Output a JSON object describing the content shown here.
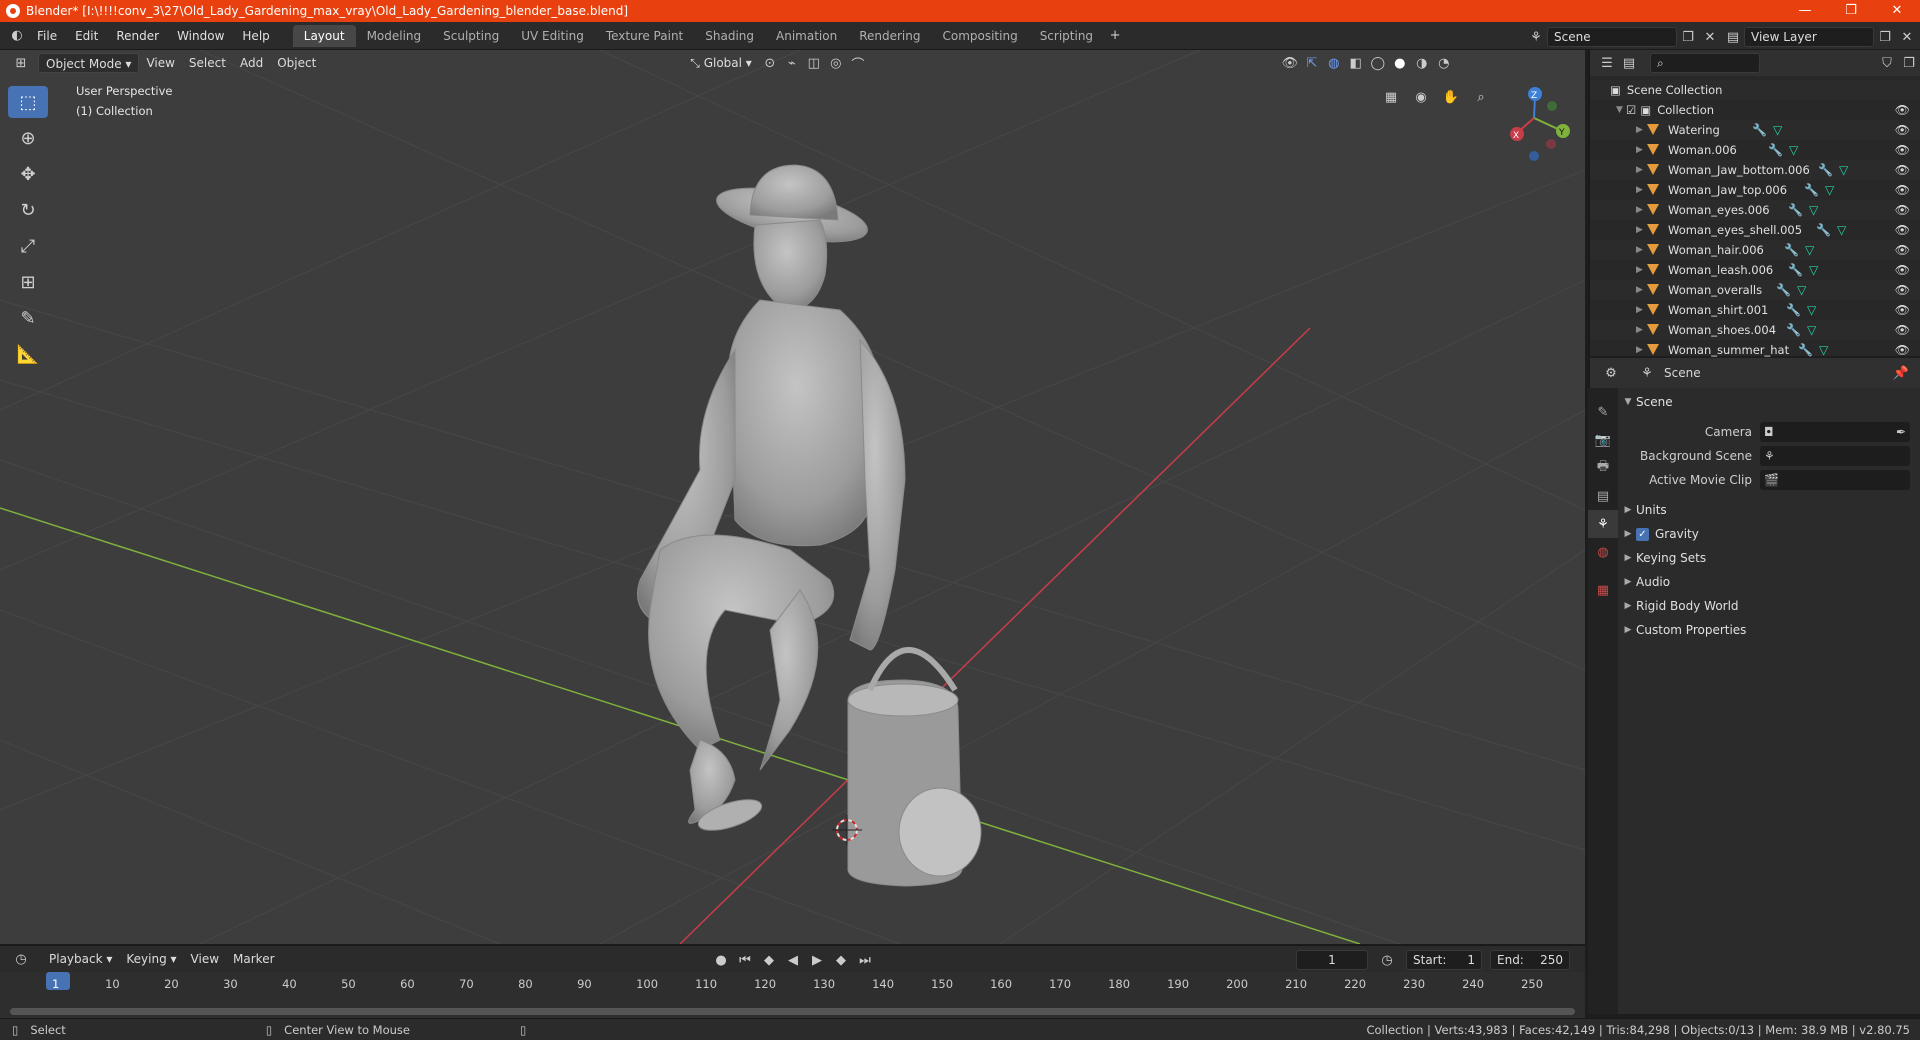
{
  "window": {
    "title": "Blender* [I:\\!!!!conv_3\\27\\Old_Lady_Gardening_max_vray\\Old_Lady_Gardening_blender_base.blend]",
    "controls": [
      "—",
      "❐",
      "✕"
    ]
  },
  "menu": [
    "File",
    "Edit",
    "Render",
    "Window",
    "Help"
  ],
  "workspaces": [
    "Layout",
    "Modeling",
    "Sculpting",
    "UV Editing",
    "Texture Paint",
    "Shading",
    "Animation",
    "Rendering",
    "Compositing",
    "Scripting"
  ],
  "active_workspace": "Layout",
  "scene_selector": "Scene",
  "view_layer": "View Layer",
  "viewport": {
    "mode": "Object Mode",
    "menus": [
      "View",
      "Select",
      "Add",
      "Object"
    ],
    "orientation": "Global",
    "perspective_label": "User Perspective",
    "collection_label": "(1) Collection",
    "gizmo_axes": {
      "x": "X",
      "y": "Y",
      "z": "Z"
    }
  },
  "outliner": {
    "root": "Scene Collection",
    "collection": "Collection",
    "objects": [
      "Watering",
      "Woman.006",
      "Woman_Jaw_bottom.006",
      "Woman_Jaw_top.006",
      "Woman_eyes.006",
      "Woman_eyes_shell.005",
      "Woman_hair.006",
      "Woman_leash.006",
      "Woman_overalls",
      "Woman_shirt.001",
      "Woman_shoes.004",
      "Woman_summer_hat"
    ]
  },
  "properties": {
    "context": "Scene",
    "panel_title": "Scene",
    "fields": [
      {
        "label": "Camera",
        "value": ""
      },
      {
        "label": "Background Scene",
        "value": ""
      },
      {
        "label": "Active Movie Clip",
        "value": ""
      }
    ],
    "subpanels": [
      "Units",
      "Gravity",
      "Keying Sets",
      "Audio",
      "Rigid Body World",
      "Custom Properties"
    ],
    "gravity_checked": true
  },
  "timeline": {
    "menus": [
      "Playback",
      "Keying",
      "View",
      "Marker"
    ],
    "current_frame": "1",
    "start_label": "Start:",
    "start": "1",
    "end_label": "End:",
    "end": "250",
    "ruler": [
      "1",
      "10",
      "20",
      "30",
      "40",
      "50",
      "60",
      "70",
      "80",
      "90",
      "100",
      "110",
      "120",
      "130",
      "140",
      "150",
      "160",
      "170",
      "180",
      "190",
      "200",
      "210",
      "220",
      "230",
      "240",
      "250"
    ]
  },
  "status": {
    "left_action": "Select",
    "middle_action": "Center View to Mouse",
    "stats": "Collection | Verts:43,983 | Faces:42,149 | Tris:84,298 | Objects:0/13 | Mem: 38.9 MB | v2.80.75"
  },
  "colors": {
    "title_bar": "#e8410f",
    "accent_blue": "#4772b3",
    "object_orange": "#e59a3c",
    "axis_x_red": "#c93c4a",
    "axis_y_green": "#7fb13c",
    "axis_z_blue": "#3e7fd8"
  }
}
